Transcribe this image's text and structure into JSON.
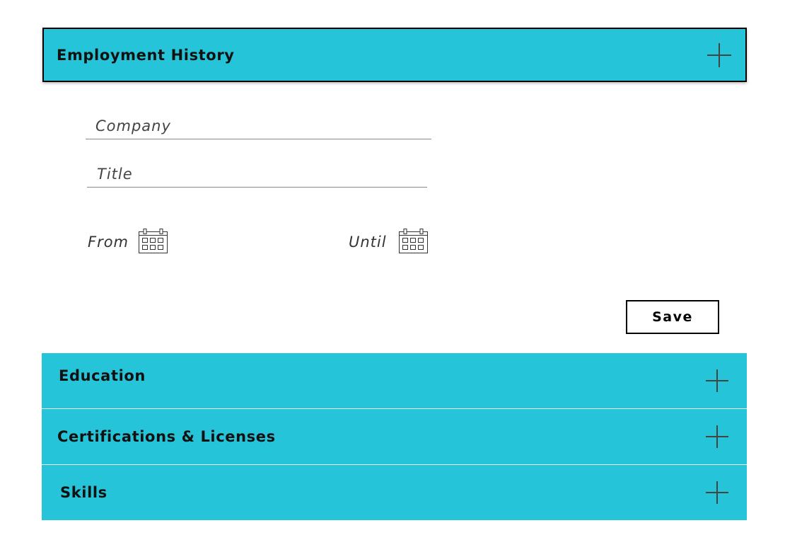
{
  "sections": {
    "employment": {
      "title": "Employment History",
      "icon": "plus-icon",
      "fields": {
        "company_placeholder": "Company",
        "title_placeholder": "Title",
        "from_label": "From",
        "until_label": "Until"
      },
      "save_label": "Save"
    },
    "education": {
      "title": "Education",
      "icon": "plus-icon"
    },
    "certifications": {
      "title": "Certifications & Licenses",
      "icon": "plus-icon"
    },
    "skills": {
      "title": "Skills",
      "icon": "plus-icon"
    }
  },
  "colors": {
    "accent": "#25c4d9",
    "border": "#000000",
    "text": "#111111"
  }
}
